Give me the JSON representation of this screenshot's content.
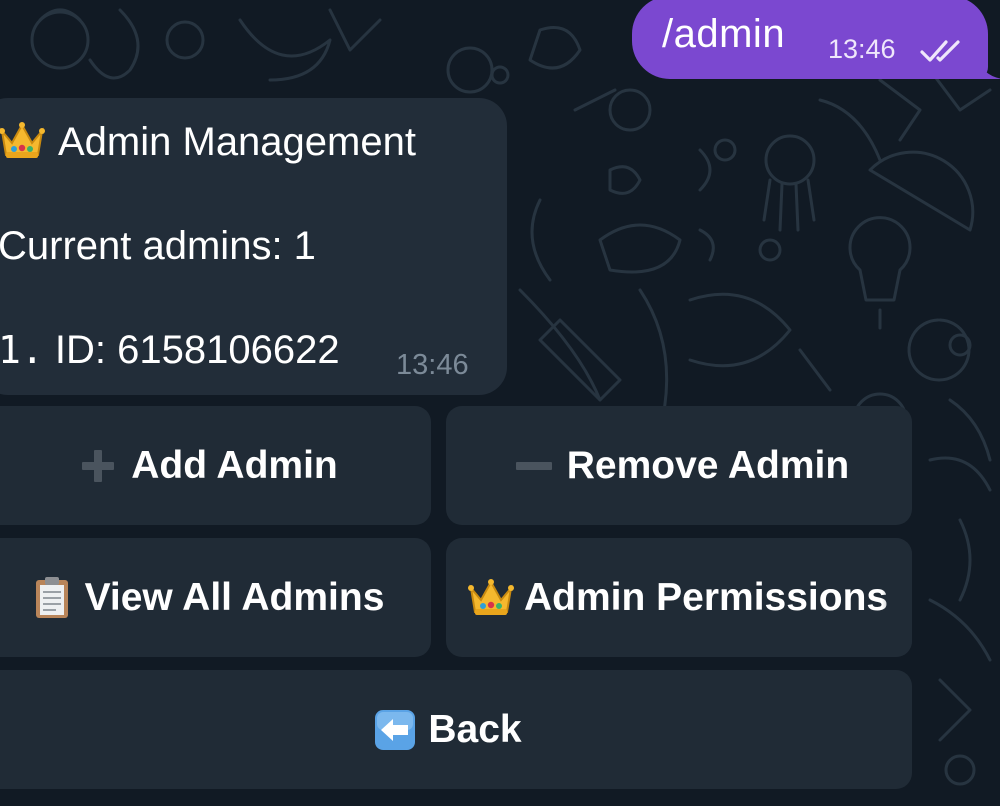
{
  "outgoing_message": {
    "text": "/admin",
    "time": "13:46",
    "status_icon": "double-check-icon"
  },
  "incoming_message": {
    "title_icon": "crown-emoji",
    "title": "Admin Management",
    "current_admins": "Current admins: 1",
    "admin_list": [
      {
        "index": "1.",
        "id_text": "ID: 6158106622"
      }
    ],
    "time": "13:46"
  },
  "inline_keyboard": {
    "add_admin": {
      "icon": "plus-icon",
      "label": "Add Admin"
    },
    "remove_admin": {
      "icon": "minus-icon",
      "label": "Remove Admin"
    },
    "view_all_admins": {
      "icon": "clipboard-emoji",
      "label": "View All Admins"
    },
    "admin_permissions": {
      "icon": "crown-emoji",
      "label": "Admin Permissions"
    },
    "back": {
      "icon": "left-arrow-emoji",
      "label": "Back"
    }
  },
  "colors": {
    "background": "#111a24",
    "outgoing_bubble": "#7b48d0",
    "incoming_bubble": "#222d39",
    "keyboard_button": "#202b36",
    "muted_time": "#7c8a98"
  }
}
